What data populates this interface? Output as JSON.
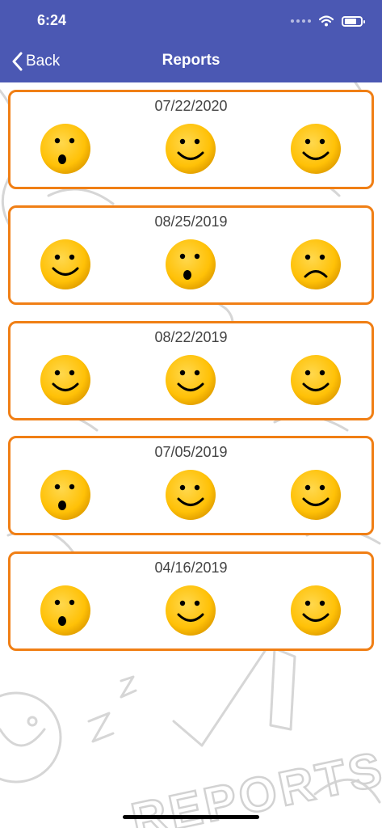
{
  "status_bar": {
    "time": "6:24"
  },
  "nav": {
    "back_label": "Back",
    "title": "Reports"
  },
  "background_text": "REPORTS",
  "reports": [
    {
      "date": "07/22/2020",
      "faces": [
        "surprised",
        "happy",
        "happy"
      ]
    },
    {
      "date": "08/25/2019",
      "faces": [
        "happy",
        "surprised",
        "sad"
      ]
    },
    {
      "date": "08/22/2019",
      "faces": [
        "happy",
        "happy",
        "happy"
      ]
    },
    {
      "date": "07/05/2019",
      "faces": [
        "surprised",
        "happy",
        "happy"
      ]
    },
    {
      "date": "04/16/2019",
      "faces": [
        "surprised",
        "happy",
        "happy"
      ]
    }
  ],
  "colors": {
    "header": "#4b58b3",
    "card_border": "#f07f15",
    "face_fill": "#ffc107",
    "face_edge": "#e6a400"
  }
}
